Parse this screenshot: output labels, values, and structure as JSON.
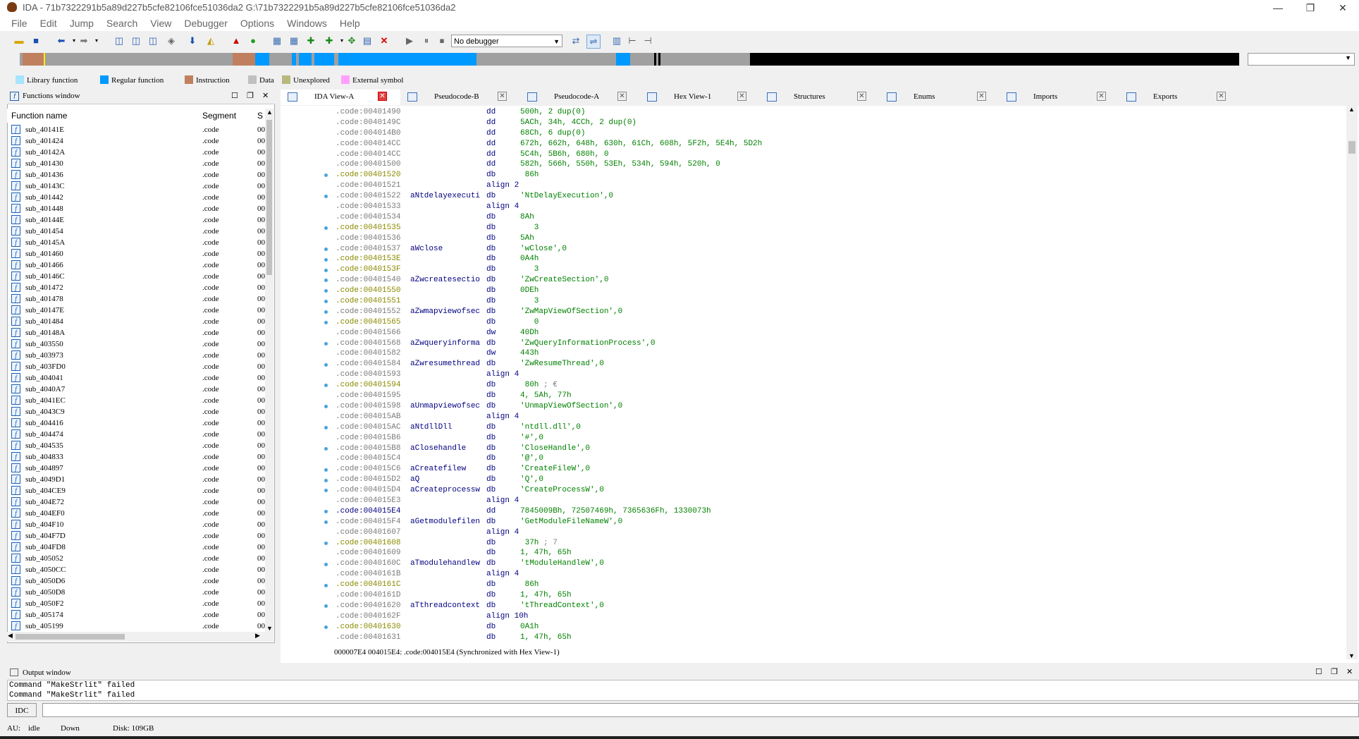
{
  "window": {
    "title": "IDA - 71b7322291b5a89d227b5cfe82106fce51036da2 G:\\71b7322291b5a89d227b5cfe82106fce51036da2"
  },
  "menu": [
    "File",
    "Edit",
    "Jump",
    "Search",
    "View",
    "Debugger",
    "Options",
    "Windows",
    "Help"
  ],
  "toolbar": {
    "debugger_select": "No debugger"
  },
  "legend": [
    {
      "label": "Library function",
      "color": "#a6e4ff"
    },
    {
      "label": "Regular function",
      "color": "#0099ff"
    },
    {
      "label": "Instruction",
      "color": "#c08060"
    },
    {
      "label": "Data",
      "color": "#c0c0c0"
    },
    {
      "label": "Unexplored",
      "color": "#b8b87c"
    },
    {
      "label": "External symbol",
      "color": "#ffa0ff"
    }
  ],
  "functions_window": {
    "title": "Functions window",
    "columns": [
      "Function name",
      "Segment",
      "S"
    ],
    "rows": [
      "sub_40141E",
      "sub_401424",
      "sub_40142A",
      "sub_401430",
      "sub_401436",
      "sub_40143C",
      "sub_401442",
      "sub_401448",
      "sub_40144E",
      "sub_401454",
      "sub_40145A",
      "sub_401460",
      "sub_401466",
      "sub_40146C",
      "sub_401472",
      "sub_401478",
      "sub_40147E",
      "sub_401484",
      "sub_40148A",
      "sub_403550",
      "sub_403973",
      "sub_403FD0",
      "sub_404041",
      "sub_4040A7",
      "sub_4041EC",
      "sub_4043C9",
      "sub_404416",
      "sub_404474",
      "sub_404535",
      "sub_404833",
      "sub_404897",
      "sub_4049D1",
      "sub_404CE9",
      "sub_404E72",
      "sub_404EF0",
      "sub_404F10",
      "sub_404F7D",
      "sub_404FD8",
      "sub_405052",
      "sub_4050CC",
      "sub_4050D6",
      "sub_4050D8",
      "sub_4050F2",
      "sub_405174",
      "sub_405199"
    ],
    "segment": ".code",
    "s_col": "00"
  },
  "tabs": [
    {
      "label": "IDA View-A",
      "active": true
    },
    {
      "label": "Pseudocode-B",
      "active": false
    },
    {
      "label": "Pseudocode-A",
      "active": false
    },
    {
      "label": "Hex View-1",
      "active": false
    },
    {
      "label": "Structures",
      "active": false
    },
    {
      "label": "Enums",
      "active": false
    },
    {
      "label": "Imports",
      "active": false
    },
    {
      "label": "Exports",
      "active": false
    }
  ],
  "ida_view": {
    "lines": [
      {
        "addr": ".code:00401490",
        "hl": false,
        "name": "",
        "ins": "dd",
        "op": "500h, 2 dup(0)",
        "cm": ""
      },
      {
        "addr": ".code:0040149C",
        "hl": false,
        "name": "",
        "ins": "dd",
        "op": "5ACh, 34h, 4CCh, 2 dup(0)",
        "cm": ""
      },
      {
        "addr": ".code:004014B0",
        "hl": false,
        "name": "",
        "ins": "dd",
        "op": "68Ch, 6 dup(0)",
        "cm": ""
      },
      {
        "addr": ".code:004014CC",
        "hl": false,
        "name": "",
        "ins": "dd",
        "op": "672h, 662h, 648h, 630h, 61Ch, 608h, 5F2h, 5E4h, 5D2h",
        "cm": ""
      },
      {
        "addr": ".code:004014CC",
        "hl": false,
        "name": "",
        "ins": "dd",
        "op": "5C4h, 5B6h, 680h, 0",
        "cm": ""
      },
      {
        "addr": ".code:00401500",
        "hl": false,
        "name": "",
        "ins": "dd",
        "op": "582h, 566h, 550h, 53Eh, 534h, 594h, 520h, 0",
        "cm": ""
      },
      {
        "addr": ".code:00401520",
        "hl": true,
        "name": "",
        "ins": "db",
        "op": " 86h",
        "cm": ""
      },
      {
        "addr": ".code:00401521",
        "hl": false,
        "name": "",
        "ins": "align 2",
        "op": "",
        "cm": ""
      },
      {
        "addr": ".code:00401522",
        "hl": false,
        "name": "aNtdelayexecuti",
        "ins": "db",
        "op": "'NtDelayExecution',0",
        "cm": ""
      },
      {
        "addr": ".code:00401533",
        "hl": false,
        "name": "",
        "ins": "align 4",
        "op": "",
        "cm": ""
      },
      {
        "addr": ".code:00401534",
        "hl": false,
        "name": "",
        "ins": "db",
        "op": "8Ah",
        "cm": ""
      },
      {
        "addr": ".code:00401535",
        "hl": true,
        "name": "",
        "ins": "db",
        "op": "   3",
        "cm": ""
      },
      {
        "addr": ".code:00401536",
        "hl": false,
        "name": "",
        "ins": "db",
        "op": "5Ah",
        "cm": ""
      },
      {
        "addr": ".code:00401537",
        "hl": false,
        "name": "aWclose",
        "ins": "db",
        "op": "'wClose',0",
        "cm": ""
      },
      {
        "addr": ".code:0040153E",
        "hl": true,
        "name": "",
        "ins": "db",
        "op": "0A4h",
        "cm": ""
      },
      {
        "addr": ".code:0040153F",
        "hl": true,
        "name": "",
        "ins": "db",
        "op": "   3",
        "cm": ""
      },
      {
        "addr": ".code:00401540",
        "hl": false,
        "name": "aZwcreatesectio",
        "ins": "db",
        "op": "'ZwCreateSection',0",
        "cm": ""
      },
      {
        "addr": ".code:00401550",
        "hl": true,
        "name": "",
        "ins": "db",
        "op": "0DEh",
        "cm": ""
      },
      {
        "addr": ".code:00401551",
        "hl": true,
        "name": "",
        "ins": "db",
        "op": "   3",
        "cm": ""
      },
      {
        "addr": ".code:00401552",
        "hl": false,
        "name": "aZwmapviewofsec",
        "ins": "db",
        "op": "'ZwMapViewOfSection',0",
        "cm": ""
      },
      {
        "addr": ".code:00401565",
        "hl": true,
        "name": "",
        "ins": "db",
        "op": "   0",
        "cm": ""
      },
      {
        "addr": ".code:00401566",
        "hl": false,
        "name": "",
        "ins": "dw",
        "op": "40Dh",
        "cm": ""
      },
      {
        "addr": ".code:00401568",
        "hl": false,
        "name": "aZwqueryinforma",
        "ins": "db",
        "op": "'ZwQueryInformationProcess',0",
        "cm": ""
      },
      {
        "addr": ".code:00401582",
        "hl": false,
        "name": "",
        "ins": "dw",
        "op": "443h",
        "cm": ""
      },
      {
        "addr": ".code:00401584",
        "hl": false,
        "name": "aZwresumethread",
        "ins": "db",
        "op": "'ZwResumeThread',0",
        "cm": ""
      },
      {
        "addr": ".code:00401593",
        "hl": false,
        "name": "",
        "ins": "align 4",
        "op": "",
        "cm": ""
      },
      {
        "addr": ".code:00401594",
        "hl": true,
        "name": "",
        "ins": "db",
        "op": " 80h",
        "cm": " ; €"
      },
      {
        "addr": ".code:00401595",
        "hl": false,
        "name": "",
        "ins": "db",
        "op": "4, 5Ah, 77h",
        "cm": ""
      },
      {
        "addr": ".code:00401598",
        "hl": false,
        "name": "aUnmapviewofsec",
        "ins": "db",
        "op": "'UnmapViewOfSection',0",
        "cm": ""
      },
      {
        "addr": ".code:004015AB",
        "hl": false,
        "name": "",
        "ins": "align 4",
        "op": "",
        "cm": ""
      },
      {
        "addr": ".code:004015AC",
        "hl": false,
        "name": "aNtdllDll",
        "ins": "db",
        "op": "'ntdll.dll',0",
        "cm": ""
      },
      {
        "addr": ".code:004015B6",
        "hl": false,
        "name": "",
        "ins": "db",
        "op": "'#',0",
        "cm": ""
      },
      {
        "addr": ".code:004015B8",
        "hl": false,
        "name": "aClosehandle",
        "ins": "db",
        "op": "'CloseHandle',0",
        "cm": ""
      },
      {
        "addr": ".code:004015C4",
        "hl": false,
        "name": "",
        "ins": "db",
        "op": "'@',0",
        "cm": ""
      },
      {
        "addr": ".code:004015C6",
        "hl": false,
        "name": "aCreatefilew",
        "ins": "db",
        "op": "'CreateFileW',0",
        "cm": ""
      },
      {
        "addr": ".code:004015D2",
        "hl": false,
        "name": "aQ",
        "ins": "db",
        "op": "'Q',0",
        "cm": ""
      },
      {
        "addr": ".code:004015D4",
        "hl": false,
        "name": "aCreateprocessw",
        "ins": "db",
        "op": "'CreateProcessW',0",
        "cm": ""
      },
      {
        "addr": ".code:004015E3",
        "hl": false,
        "name": "",
        "ins": "align 4",
        "op": "",
        "cm": ""
      },
      {
        "addr": ".code:004015E4",
        "hl": "cur",
        "name": "",
        "ins": "dd",
        "op": "7845009Bh, 72507469h, 7365636Fh, 1330073h",
        "cm": ""
      },
      {
        "addr": ".code:004015F4",
        "hl": false,
        "name": "aGetmodulefilen",
        "ins": "db",
        "op": "'GetModuleFileNameW',0",
        "cm": ""
      },
      {
        "addr": ".code:00401607",
        "hl": false,
        "name": "",
        "ins": "align 4",
        "op": "",
        "cm": ""
      },
      {
        "addr": ".code:00401608",
        "hl": true,
        "name": "",
        "ins": "db",
        "op": " 37h",
        "cm": " ; 7"
      },
      {
        "addr": ".code:00401609",
        "hl": false,
        "name": "",
        "ins": "db",
        "op": "1, 47h, 65h",
        "cm": ""
      },
      {
        "addr": ".code:0040160C",
        "hl": false,
        "name": "aTmodulehandlew",
        "ins": "db",
        "op": "'tModuleHandleW',0",
        "cm": ""
      },
      {
        "addr": ".code:0040161B",
        "hl": false,
        "name": "",
        "ins": "align 4",
        "op": "",
        "cm": ""
      },
      {
        "addr": ".code:0040161C",
        "hl": true,
        "name": "",
        "ins": "db",
        "op": " 86h",
        "cm": ""
      },
      {
        "addr": ".code:0040161D",
        "hl": false,
        "name": "",
        "ins": "db",
        "op": "1, 47h, 65h",
        "cm": ""
      },
      {
        "addr": ".code:00401620",
        "hl": false,
        "name": "aTthreadcontext",
        "ins": "db",
        "op": "'tThreadContext',0",
        "cm": ""
      },
      {
        "addr": ".code:0040162F",
        "hl": false,
        "name": "",
        "ins": "align 10h",
        "op": "",
        "cm": ""
      },
      {
        "addr": ".code:00401630",
        "hl": true,
        "name": "",
        "ins": "db",
        "op": "0A1h",
        "cm": ""
      },
      {
        "addr": ".code:00401631",
        "hl": false,
        "name": "",
        "ins": "db",
        "op": "1, 47h, 65h",
        "cm": ""
      }
    ],
    "status": "000007E4 004015E4: .code:004015E4 (Synchronized with Hex View-1)"
  },
  "output_window": {
    "title": "Output window",
    "lines": [
      "Command \"MakeStrlit\" failed",
      "Command \"MakeStrlit\" failed"
    ]
  },
  "command": {
    "button": "IDC"
  },
  "statusbar": {
    "au": "AU:",
    "au_state": "idle",
    "direction": "Down",
    "disk": "Disk: 109GB"
  }
}
